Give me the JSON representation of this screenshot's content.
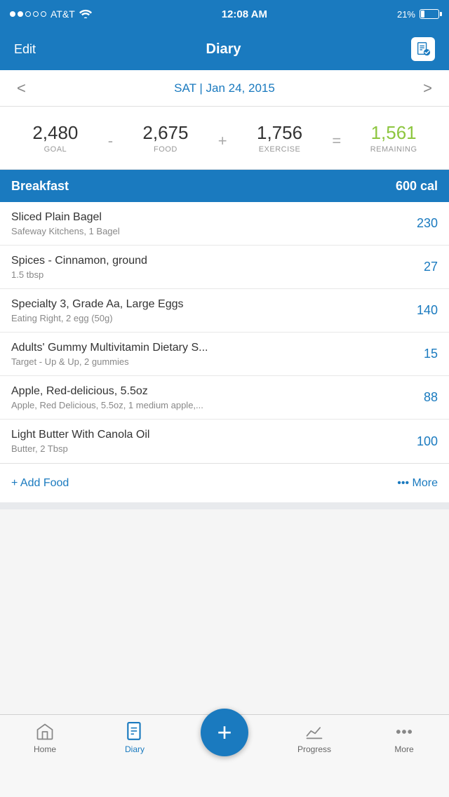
{
  "status": {
    "carrier": "AT&T",
    "time": "12:08 AM",
    "battery": "21%"
  },
  "navbar": {
    "edit_label": "Edit",
    "title": "Diary",
    "icon_alt": "diary-check"
  },
  "date_nav": {
    "prev_arrow": "<",
    "next_arrow": ">",
    "date_text": "SAT | Jan 24, 2015"
  },
  "summary": {
    "goal_value": "2,480",
    "goal_label": "GOAL",
    "minus": "-",
    "food_value": "2,675",
    "food_label": "FOOD",
    "plus": "+",
    "exercise_value": "1,756",
    "exercise_label": "EXERCISE",
    "equals": "=",
    "remaining_value": "1,561",
    "remaining_label": "REMAINING"
  },
  "breakfast": {
    "section_title": "Breakfast",
    "section_cal": "600 cal",
    "items": [
      {
        "name": "Sliced Plain Bagel",
        "detail": "Safeway Kitchens, 1 Bagel",
        "cal": "230"
      },
      {
        "name": "Spices - Cinnamon, ground",
        "detail": "1.5 tbsp",
        "cal": "27"
      },
      {
        "name": "Specialty 3, Grade Aa, Large Eggs",
        "detail": "Eating Right, 2 egg (50g)",
        "cal": "140"
      },
      {
        "name": "Adults' Gummy Multivitamin Dietary S...",
        "detail": "Target - Up & Up, 2 gummies",
        "cal": "15"
      },
      {
        "name": "Apple, Red-delicious, 5.5oz",
        "detail": "Apple, Red Delicious, 5.5oz, 1 medium apple,...",
        "cal": "88"
      },
      {
        "name": "Light Butter With Canola Oil",
        "detail": "Butter, 2 Tbsp",
        "cal": "100"
      }
    ],
    "add_food_label": "+ Add Food",
    "more_label": "••• More"
  },
  "tabs": [
    {
      "id": "home",
      "label": "Home",
      "icon": "home"
    },
    {
      "id": "diary",
      "label": "Diary",
      "icon": "diary",
      "active": true
    },
    {
      "id": "add",
      "label": "",
      "icon": "plus"
    },
    {
      "id": "progress",
      "label": "Progress",
      "icon": "progress"
    },
    {
      "id": "more",
      "label": "More",
      "icon": "more"
    }
  ]
}
